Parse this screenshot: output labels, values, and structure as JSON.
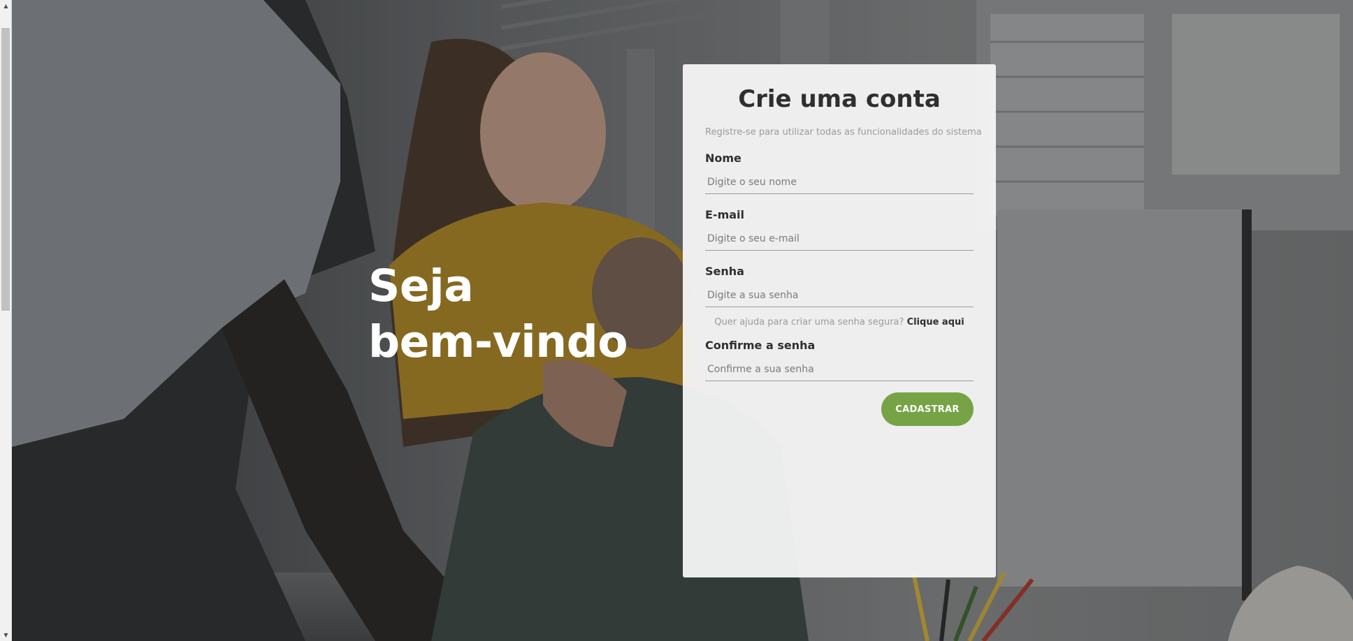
{
  "hero": {
    "line1": "Seja",
    "line2": "bem-vindo"
  },
  "form": {
    "title": "Crie uma conta",
    "subtitle": "Registre-se para utilizar todas as funcionalidades do sistema",
    "name": {
      "label": "Nome",
      "placeholder": "Digite o seu nome",
      "value": ""
    },
    "email": {
      "label": "E-mail",
      "placeholder": "Digite o seu e-mail",
      "value": ""
    },
    "password": {
      "label": "Senha",
      "placeholder": "Digite a sua senha",
      "value": ""
    },
    "password_help": {
      "text": "Quer ajuda para criar uma senha segura?",
      "link": "Clique aqui"
    },
    "confirm": {
      "label": "Confirme a senha",
      "placeholder": "Confirme a sua senha",
      "value": ""
    },
    "submit_label": "CADASTRAR"
  },
  "colors": {
    "accent": "#76a346",
    "title": "#2f2f2f",
    "muted": "#9b9b9b"
  },
  "icons": {
    "scroll_up": "triangle-up-icon",
    "scroll_down": "triangle-down-icon"
  }
}
